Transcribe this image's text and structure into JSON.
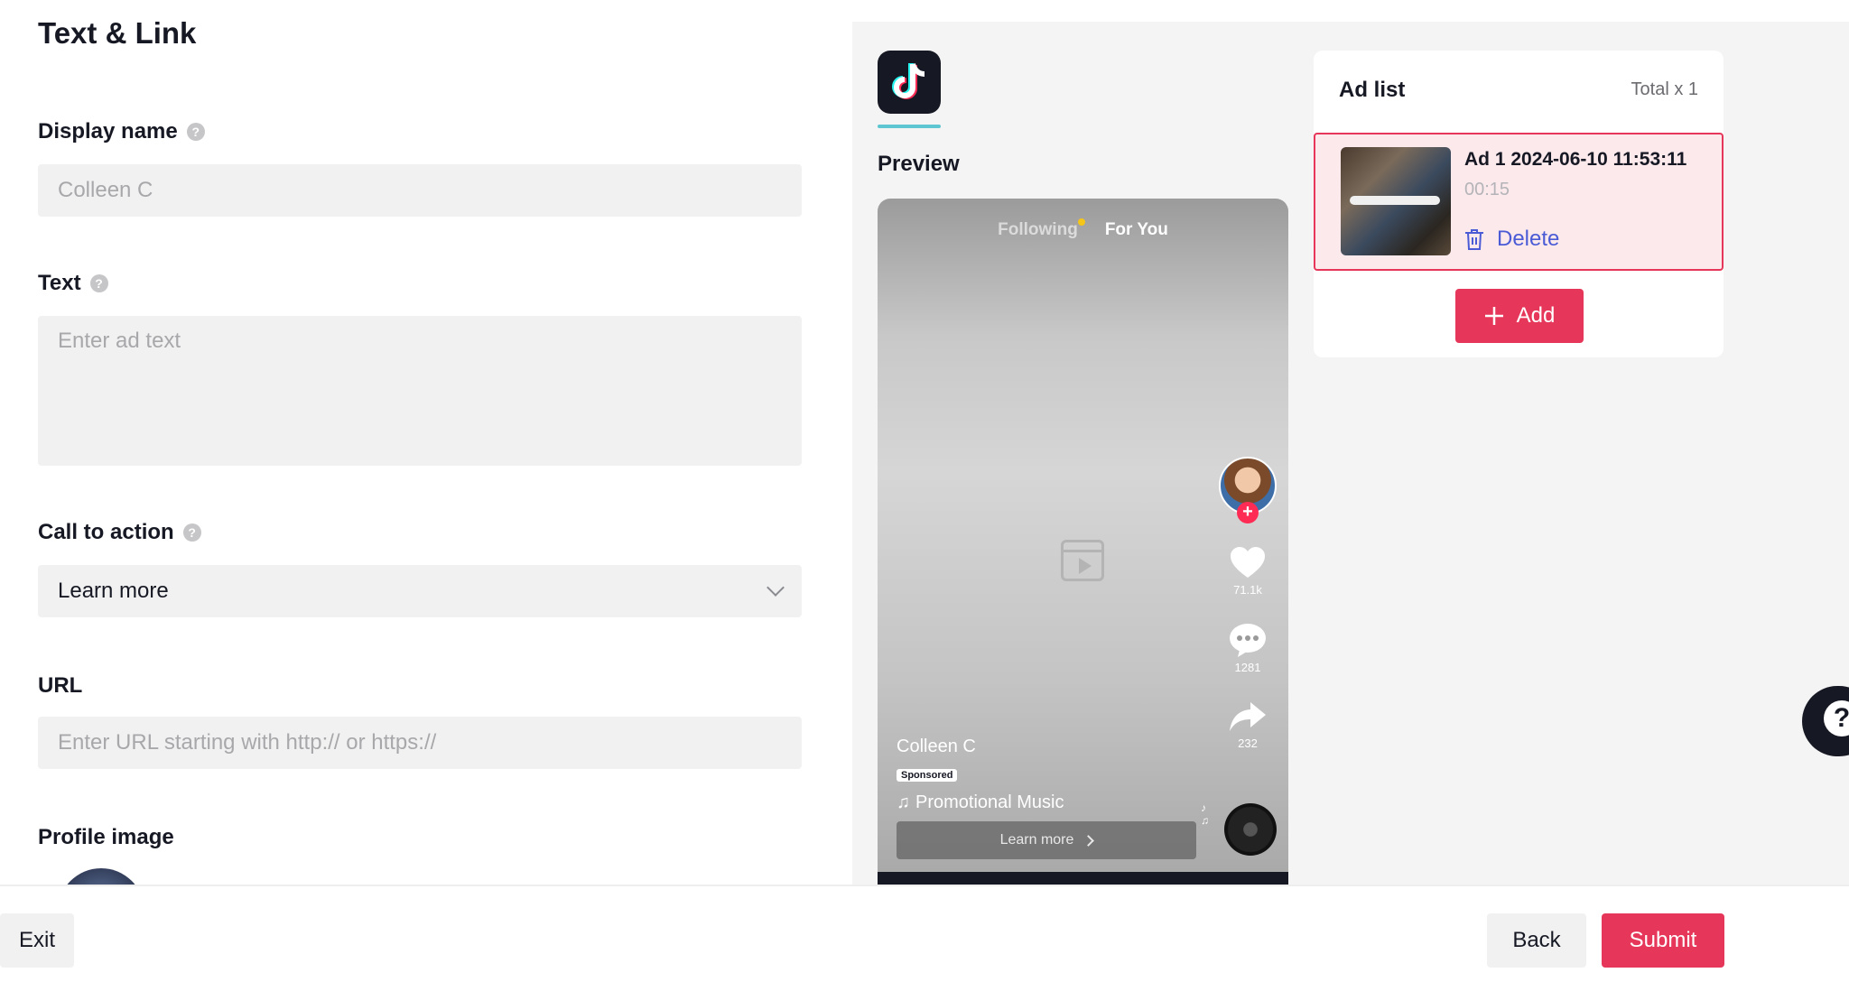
{
  "form": {
    "title": "Text & Link",
    "display_name": {
      "label": "Display name",
      "placeholder": "Colleen C"
    },
    "text": {
      "label": "Text",
      "placeholder": "Enter ad text"
    },
    "cta": {
      "label": "Call to action",
      "value": "Learn more"
    },
    "url": {
      "label": "URL",
      "placeholder": "Enter URL starting with http:// or https://"
    },
    "profile_image": {
      "label": "Profile image"
    }
  },
  "preview": {
    "label": "Preview",
    "tabs": {
      "following": "Following",
      "for_you": "For You"
    },
    "likes": "71.1k",
    "comments": "1281",
    "shares": "232",
    "author": "Colleen C",
    "sponsored": "Sponsored",
    "music": "Promotional Music",
    "cta": "Learn more"
  },
  "ad_list": {
    "title": "Ad list",
    "total": "Total x 1",
    "items": [
      {
        "name": "Ad 1 2024-06-10 11:53:11",
        "duration": "00:15",
        "delete_label": "Delete"
      }
    ],
    "add_label": "Add"
  },
  "footer": {
    "exit": "Exit",
    "back": "Back",
    "submit": "Submit"
  },
  "colors": {
    "accent": "#e6375a",
    "link": "#4b5bd6",
    "selected_bg": "#fbe9ec"
  }
}
